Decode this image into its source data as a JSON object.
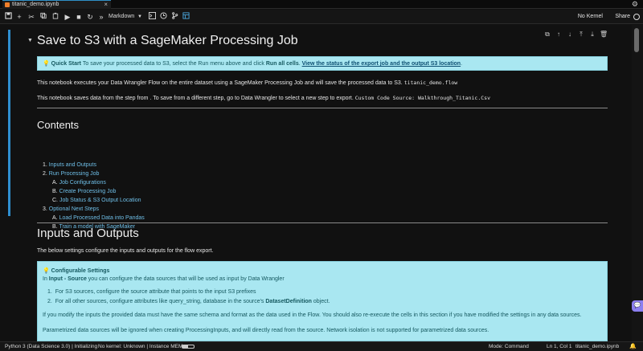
{
  "tab": {
    "title": "titanic_demo.ipynb",
    "close": "×"
  },
  "toolbar": {
    "cell_type": "Markdown",
    "kernel": "No Kernel",
    "share": "Share"
  },
  "notebook": {
    "title": "Save to S3 with a SageMaker Processing Job",
    "quick_start": {
      "icon": "💡",
      "label": "Quick Start",
      "text1": " To save your processed data to S3, select the Run menu above and click ",
      "bold": "Run all cells",
      "text2": ". ",
      "link": "View the status of the export job and the output S3 location",
      "text3": "."
    },
    "para1": "This notebook executes your Data Wrangler Flow on the entire dataset using a SageMaker Processing Job and will save the processed data to S3. ",
    "para1_code": "titanic_demo.flow",
    "para2": "This notebook saves data from the step from . To save from a different step, go to Data Wrangler to select a new step to export. ",
    "para2_code": "Custom Code Source: Walkthrough_Titanic.Csv",
    "contents_heading": "Contents",
    "toc": [
      {
        "n": "1. ",
        "label": "Inputs and Outputs",
        "indent": 0
      },
      {
        "n": "2. ",
        "label": "Run Processing Job",
        "indent": 0
      },
      {
        "n": "A. ",
        "label": "Job Configurations",
        "indent": 1
      },
      {
        "n": "B. ",
        "label": "Create Processing Job",
        "indent": 1
      },
      {
        "n": "C. ",
        "label": "Job Status & S3 Output Location",
        "indent": 1
      },
      {
        "n": "3. ",
        "label": "Optional Next Steps",
        "indent": 0
      },
      {
        "n": "A. ",
        "label": "Load Processed Data into Pandas",
        "indent": 1
      },
      {
        "n": "B. ",
        "label": "Train a model with SageMaker",
        "indent": 1
      }
    ],
    "io_heading": "Inputs and Outputs",
    "io_para": "The below settings configure the inputs and outputs for the flow export.",
    "config": {
      "icon": "💡",
      "label": "Configurable Settings",
      "line1_pre": "In ",
      "line1_bold": "Input - Source",
      "line1_post": " you can configure the data sources that will be used as input by Data Wrangler",
      "bullet1": "For S3 sources, configure the source attribute that points to the input S3 prefixes",
      "bullet2_pre": "For all other sources, configure attributes like query_string, database in the source's ",
      "bullet2_bold": "DatasetDefinition",
      "bullet2_post": " object.",
      "para_a": "If you modify the inputs the provided data must have the same schema and format as the data used in the Flow. You should also re-execute the cells in this section if you have modified the settings in any data sources.",
      "para_b": "Parametrized data sources will be ignored when creating ProcessingInputs, and will directly read from the source. Network isolation is not supported for parametrized data sources."
    }
  },
  "status": {
    "kernel_info": "Python 3 (Data Science 3.0) | Initializing",
    "no_kernel": "No kernel: Unknown | Instance MEM",
    "mode": "Mode: Command",
    "position": "Ln 1, Col 1",
    "file": "titanic_demo.ipynb",
    "memory_fraction": 0.5
  },
  "colors": {
    "accent": "#2f8fd0",
    "alert_bg": "#a9e7f1",
    "link": "#6fbfe8"
  }
}
